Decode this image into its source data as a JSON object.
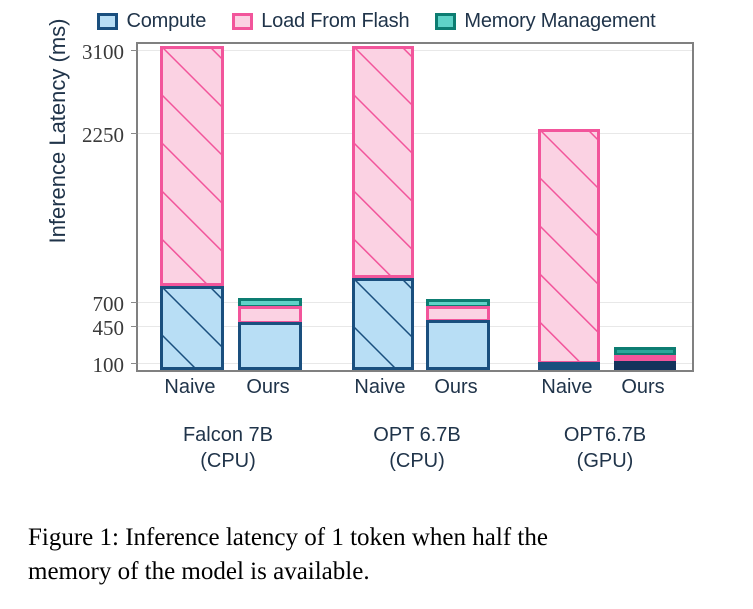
{
  "chart_data": {
    "type": "bar",
    "subtype": "stacked-grouped",
    "title": "",
    "xlabel": "",
    "ylabel": "Inference Latency (ms)",
    "ylim": [
      0,
      3250
    ],
    "grid": true,
    "yticks": [
      100,
      450,
      700,
      2250,
      3100
    ],
    "ytick_labels": [
      "100",
      "450",
      "700",
      "2250",
      "3100"
    ],
    "axis_scale": "nonlinear-broken",
    "legend_position": "top-center",
    "legend": [
      "Compute",
      "Load From Flash",
      "Memory Management"
    ],
    "categories": [
      "Naive",
      "Ours",
      "Naive",
      "Ours",
      "Naive",
      "Ours"
    ],
    "groups": [
      {
        "line1": "Falcon 7B",
        "line2": "(CPU)"
      },
      {
        "line1": "OPT 6.7B",
        "line2": "(CPU)"
      },
      {
        "line1": "OPT6.7B",
        "line2": "(GPU)"
      }
    ],
    "series": [
      {
        "name": "Compute",
        "values": [
          760,
          430,
          810,
          500,
          110,
          100
        ]
      },
      {
        "name": "Load From Flash",
        "values": [
          2340,
          180,
          2290,
          150,
          2150,
          60
        ]
      },
      {
        "name": "Memory Management",
        "values": [
          0,
          90,
          0,
          60,
          0,
          80
        ]
      }
    ],
    "totals": [
      3100,
      700,
      3100,
      710,
      2260,
      240
    ],
    "bars": [
      {
        "group": "Falcon 7B (CPU)",
        "variant": "Naive",
        "hatched": true,
        "compute": 760,
        "load_from_flash": 2340,
        "memory_management": 0,
        "total": 3100
      },
      {
        "group": "Falcon 7B (CPU)",
        "variant": "Ours",
        "hatched": false,
        "compute": 430,
        "load_from_flash": 180,
        "memory_management": 90,
        "total": 700
      },
      {
        "group": "OPT 6.7B (CPU)",
        "variant": "Naive",
        "hatched": true,
        "compute": 810,
        "load_from_flash": 2290,
        "memory_management": 0,
        "total": 3100
      },
      {
        "group": "OPT 6.7B (CPU)",
        "variant": "Ours",
        "hatched": false,
        "compute": 500,
        "load_from_flash": 150,
        "memory_management": 60,
        "total": 710
      },
      {
        "group": "OPT6.7B (GPU)",
        "variant": "Naive",
        "hatched": true,
        "compute": 110,
        "load_from_flash": 2150,
        "memory_management": 0,
        "total": 2260
      },
      {
        "group": "OPT6.7B (GPU)",
        "variant": "Ours",
        "hatched": false,
        "compute": 100,
        "load_from_flash": 60,
        "memory_management": 80,
        "total": 240
      }
    ]
  },
  "colors": {
    "compute_fill": "#b8def5",
    "compute_border": "#1a4f7e",
    "flash_fill": "#fbd2e3",
    "flash_border": "#f2559b",
    "memory_fill": "#5fd3c8",
    "memory_border": "#0d7d72",
    "grid": "#e8e8e8",
    "axis": "#808080",
    "text": "#20344a"
  },
  "legend": {
    "items": [
      {
        "label": "Compute",
        "icon": "square-swatch-compute"
      },
      {
        "label": "Load From Flash",
        "icon": "square-swatch-flash"
      },
      {
        "label": "Memory Management",
        "icon": "square-swatch-memory"
      }
    ]
  },
  "yaxis": {
    "title": "Inference Latency (ms)",
    "ticks": [
      "3100",
      "2250",
      "700",
      "450",
      "100"
    ]
  },
  "xaxis": {
    "ticks": [
      "Naive",
      "Ours",
      "Naive",
      "Ours",
      "Naive",
      "Ours"
    ],
    "groups": [
      {
        "line1": "Falcon 7B",
        "line2": "(CPU)"
      },
      {
        "line1": "OPT 6.7B",
        "line2": "(CPU)"
      },
      {
        "line1": "OPT6.7B",
        "line2": "(GPU)"
      }
    ]
  },
  "caption": {
    "line1": "Figure 1:  Inference latency of 1 token when half the",
    "line2": "memory of the model is available."
  }
}
